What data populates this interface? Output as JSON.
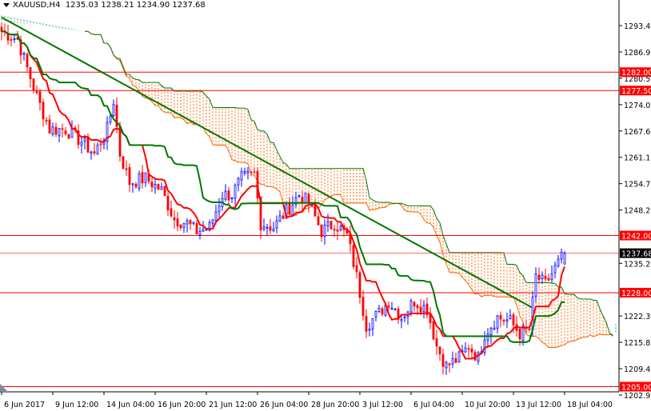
{
  "header": {
    "symbol": "XAUUSD,H4",
    "ohlc": "1235.03 1238.21 1234.90 1237.68"
  },
  "chart_data": {
    "type": "candlestick",
    "symbol": "XAUUSD",
    "timeframe": "H4",
    "ylim": [
      1202.95,
      1293.4
    ],
    "y_ticks": [
      "1293.40",
      "1286.95",
      "1280.50",
      "1274.05",
      "1267.60",
      "1261.15",
      "1254.70",
      "1248.25",
      "1235.20",
      "1222.30",
      "1215.85",
      "1209.40",
      "1202.95"
    ],
    "x_ticks": [
      {
        "bar": 0,
        "label": "6 Jun 2017"
      },
      {
        "bar": 16,
        "label": "9 Jun 12:00"
      },
      {
        "bar": 32,
        "label": "14 Jun 04:00"
      },
      {
        "bar": 48,
        "label": "16 Jun 20:00"
      },
      {
        "bar": 64,
        "label": "21 Jun 12:00"
      },
      {
        "bar": 80,
        "label": "26 Jun 04:00"
      },
      {
        "bar": 96,
        "label": "28 Jun 20:00"
      },
      {
        "bar": 112,
        "label": "3 Jul 12:00"
      },
      {
        "bar": 128,
        "label": "6 Jul 04:00"
      },
      {
        "bar": 144,
        "label": "10 Jul 20:00"
      },
      {
        "bar": 160,
        "label": "13 Jul 12:00"
      },
      {
        "bar": 176,
        "label": "18 Jul 04:00"
      }
    ],
    "close_path": [
      [
        0,
        1292
      ],
      [
        5,
        1290
      ],
      [
        8,
        1283
      ],
      [
        11,
        1276
      ],
      [
        15,
        1268
      ],
      [
        20,
        1268
      ],
      [
        25,
        1265
      ],
      [
        29,
        1262
      ],
      [
        33,
        1268
      ],
      [
        35,
        1275
      ],
      [
        37,
        1262
      ],
      [
        40,
        1255
      ],
      [
        45,
        1256
      ],
      [
        50,
        1253
      ],
      [
        54,
        1246
      ],
      [
        58,
        1245
      ],
      [
        61,
        1243
      ],
      [
        65,
        1244
      ],
      [
        69,
        1252
      ],
      [
        72,
        1252
      ],
      [
        75,
        1256
      ],
      [
        79,
        1257
      ],
      [
        81,
        1245
      ],
      [
        85,
        1244
      ],
      [
        89,
        1248
      ],
      [
        93,
        1252
      ],
      [
        96,
        1250
      ],
      [
        100,
        1243
      ],
      [
        104,
        1245
      ],
      [
        108,
        1242
      ],
      [
        111,
        1232
      ],
      [
        114,
        1220
      ],
      [
        118,
        1223
      ],
      [
        121,
        1226
      ],
      [
        125,
        1222
      ],
      [
        129,
        1226
      ],
      [
        133,
        1224
      ],
      [
        136,
        1215
      ],
      [
        139,
        1210
      ],
      [
        143,
        1212
      ],
      [
        146,
        1215
      ],
      [
        149,
        1212
      ],
      [
        151,
        1218
      ],
      [
        155,
        1222
      ],
      [
        159,
        1221
      ],
      [
        162,
        1218
      ],
      [
        165,
        1219
      ],
      [
        167,
        1232
      ],
      [
        170,
        1230
      ],
      [
        173,
        1234
      ],
      [
        176,
        1237.68
      ]
    ],
    "levels": [
      {
        "price": 1282.0,
        "label": "1282.00"
      },
      {
        "price": 1277.5,
        "label": "1277.50"
      },
      {
        "price": 1242.0,
        "label": "1242.00"
      },
      {
        "price": 1228.0,
        "label": "1228.00"
      },
      {
        "price": 1205.0,
        "label": "1205.00"
      }
    ],
    "current_price": {
      "price": 1237.68,
      "label": "1237.68"
    },
    "trendline": {
      "from": {
        "bar": 0,
        "price": 1295.4
      },
      "to": {
        "bar": 166,
        "price": 1224.3
      }
    },
    "indicators": [
      "Ichimoku Tenkan-sen (red)",
      "Ichimoku Kijun-sen (green)",
      "Ichimoku cloud"
    ],
    "colors": {
      "bull": "#0000ff",
      "bear": "#ff0000",
      "tenkan": "#ff0000",
      "kijun": "#007700",
      "cloud_bear": "#ff6600",
      "cloud_bull": "#00aa44",
      "trend": "#007700",
      "level": "#ff0000"
    }
  }
}
